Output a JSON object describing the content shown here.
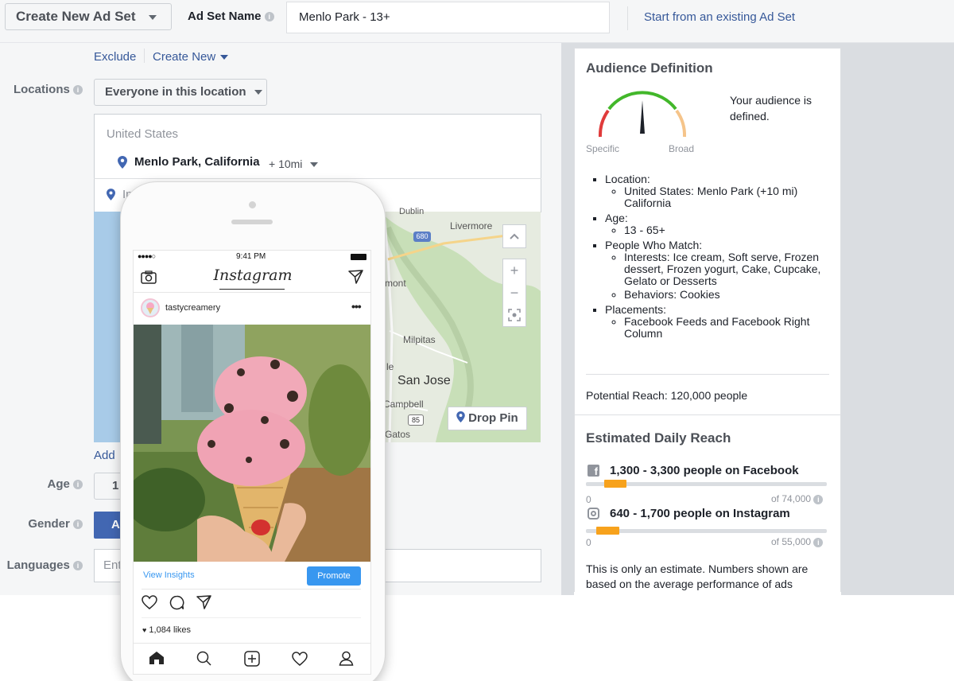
{
  "topbar": {
    "create_dropdown": "Create New Ad Set",
    "ad_set_name_label": "Ad Set Name",
    "ad_set_name_value": "Menlo Park - 13+",
    "start_existing_link": "Start from an existing Ad Set"
  },
  "audience_form": {
    "exclude_link": "Exclude",
    "create_new_link": "Create New",
    "locations_label": "Locations",
    "location_type_dropdown": "Everyone in this location",
    "country": "United States",
    "city": "Menlo Park, California",
    "radius": "+ 10mi",
    "include_partial": "In",
    "add_link_partial": "Add",
    "age_label": "Age",
    "age_partial": "1",
    "gender_label": "Gender",
    "gender_partial": "A",
    "languages_label": "Languages",
    "languages_placeholder_partial": "Ent"
  },
  "map": {
    "labels": {
      "dublin": "Dublin",
      "livermore": "Livermore",
      "fremont": "mont",
      "milpitas": "Milpitas",
      "sanjose": "San Jose",
      "campbell": "Campbell",
      "gatos": "Gatos",
      "le": "le",
      "hwy680": "680",
      "hwy85": "85"
    },
    "drop_pin": "Drop Pin",
    "zoom_in": "+",
    "zoom_out": "−"
  },
  "phone": {
    "time": "9:41 PM",
    "app_title": "Instagram",
    "username": "tastycreamery",
    "view_insights": "View Insights",
    "promote": "Promote",
    "likes": "1,084 likes"
  },
  "audience_definition": {
    "title": "Audience Definition",
    "status": "Your audience is defined.",
    "gauge_left": "Specific",
    "gauge_right": "Broad",
    "location_heading": "Location:",
    "location_value": "United States: Menlo Park (+10 mi) California",
    "age_heading": "Age:",
    "age_value": "13 - 65+",
    "people_heading": "People Who Match:",
    "interests": "Interests: Ice cream, Soft serve, Frozen dessert, Frozen yogurt, Cake, Cupcake, Gelato or Desserts",
    "behaviors": "Behaviors: Cookies",
    "placements_heading": "Placements:",
    "placements_value": "Facebook Feeds and Facebook Right Column",
    "potential_reach": "Potential Reach: 120,000 people",
    "gauge_level": 0.5
  },
  "daily_reach": {
    "title": "Estimated Daily Reach",
    "facebook": {
      "text": "1,300 - 3,300 people on Facebook",
      "min": "0",
      "max": "of 74,000",
      "fill_start": 0.076,
      "fill_end": 0.17
    },
    "instagram": {
      "text": "640 - 1,700 people on Instagram",
      "min": "0",
      "max": "of 55,000",
      "fill_start": 0.043,
      "fill_end": 0.14
    },
    "note": "This is only an estimate. Numbers shown are based on the average performance of ads"
  },
  "colors": {
    "facebook_blue": "#4267b2",
    "link_blue": "#365899",
    "reach_orange": "#f7a21c",
    "instagram_button": "#3897f0"
  }
}
